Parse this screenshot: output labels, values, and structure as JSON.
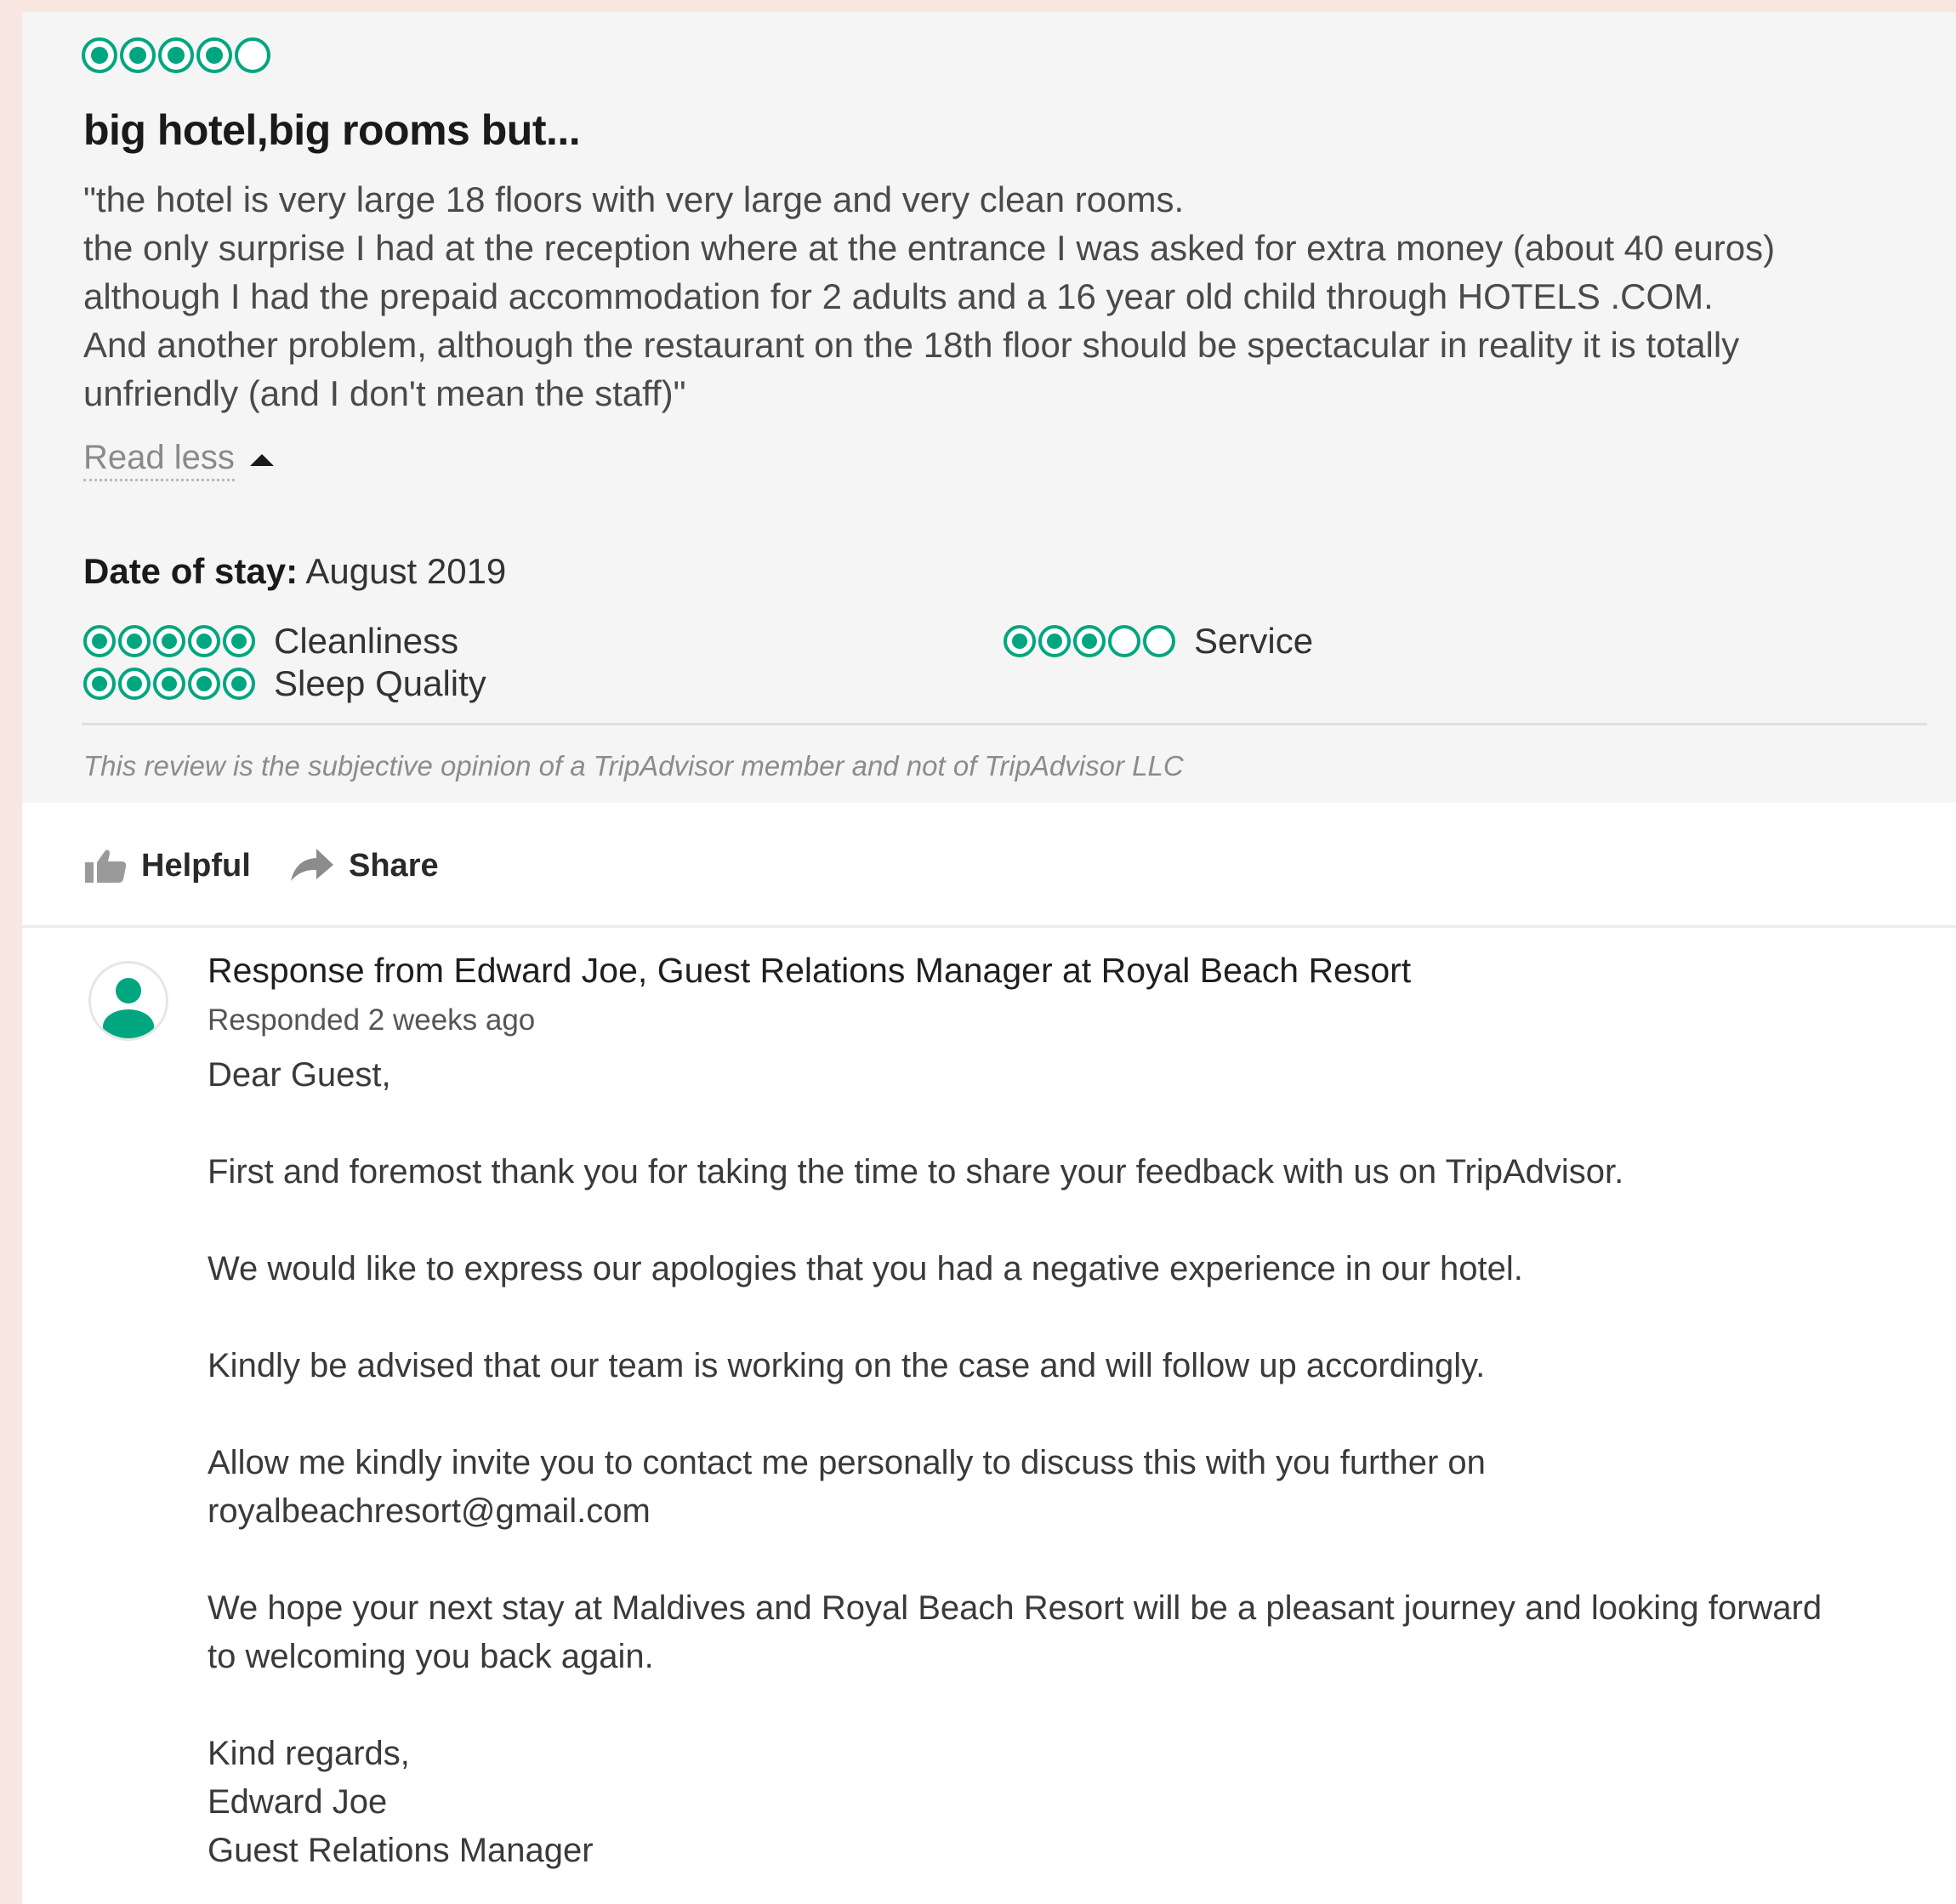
{
  "review": {
    "rating": 4,
    "rating_max": 5,
    "title": "big hotel,big rooms but...",
    "body_lines": [
      "\"the hotel is very large 18 floors with very large and very clean rooms.",
      "the only surprise I had at the reception where at the entrance I was asked for extra money (about 40 euros)",
      "although I had the prepaid accommodation for 2 adults and a 16 year old child through HOTELS .COM.",
      "And another problem, although the restaurant on the 18th floor should be spectacular in reality it is totally",
      "unfriendly (and I don't mean the staff)\""
    ],
    "read_less": "Read less",
    "date_label": "Date of stay:",
    "date_value": "August 2019",
    "sub_ratings": [
      {
        "label": "Cleanliness",
        "rating": 5
      },
      {
        "label": "Service",
        "rating": 3
      },
      {
        "label": "Sleep Quality",
        "rating": 5
      }
    ],
    "disclaimer": "This review is the subjective opinion of a TripAdvisor member and not of TripAdvisor LLC"
  },
  "actions": {
    "helpful": "Helpful",
    "share": "Share"
  },
  "response": {
    "title": "Response from Edward Joe, Guest Relations Manager at Royal Beach Resort",
    "meta": "Responded 2 weeks ago",
    "greeting": "Dear Guest,",
    "p1": "First and foremost thank you for taking the time to share your feedback with us on TripAdvisor.",
    "p2": "We would like to express our apologies that you had a negative experience in our hotel.",
    "p3": "Kindly be advised that our team is working on the case and will follow up accordingly.",
    "p4_line1": "Allow me kindly invite you to contact me personally to discuss this with you further on",
    "p4_line2": "royalbeachresort@gmail.com",
    "p5_line1": "We hope your next stay at Maldives and Royal Beach Resort will be a pleasant journey and looking forward",
    "p5_line2": "to welcoming you back again.",
    "sign1": "Kind regards,",
    "sign2": "Edward Joe",
    "sign3": "Guest Relations Manager"
  },
  "colors": {
    "bubble": "#00a680",
    "avatar": "#00a680"
  }
}
